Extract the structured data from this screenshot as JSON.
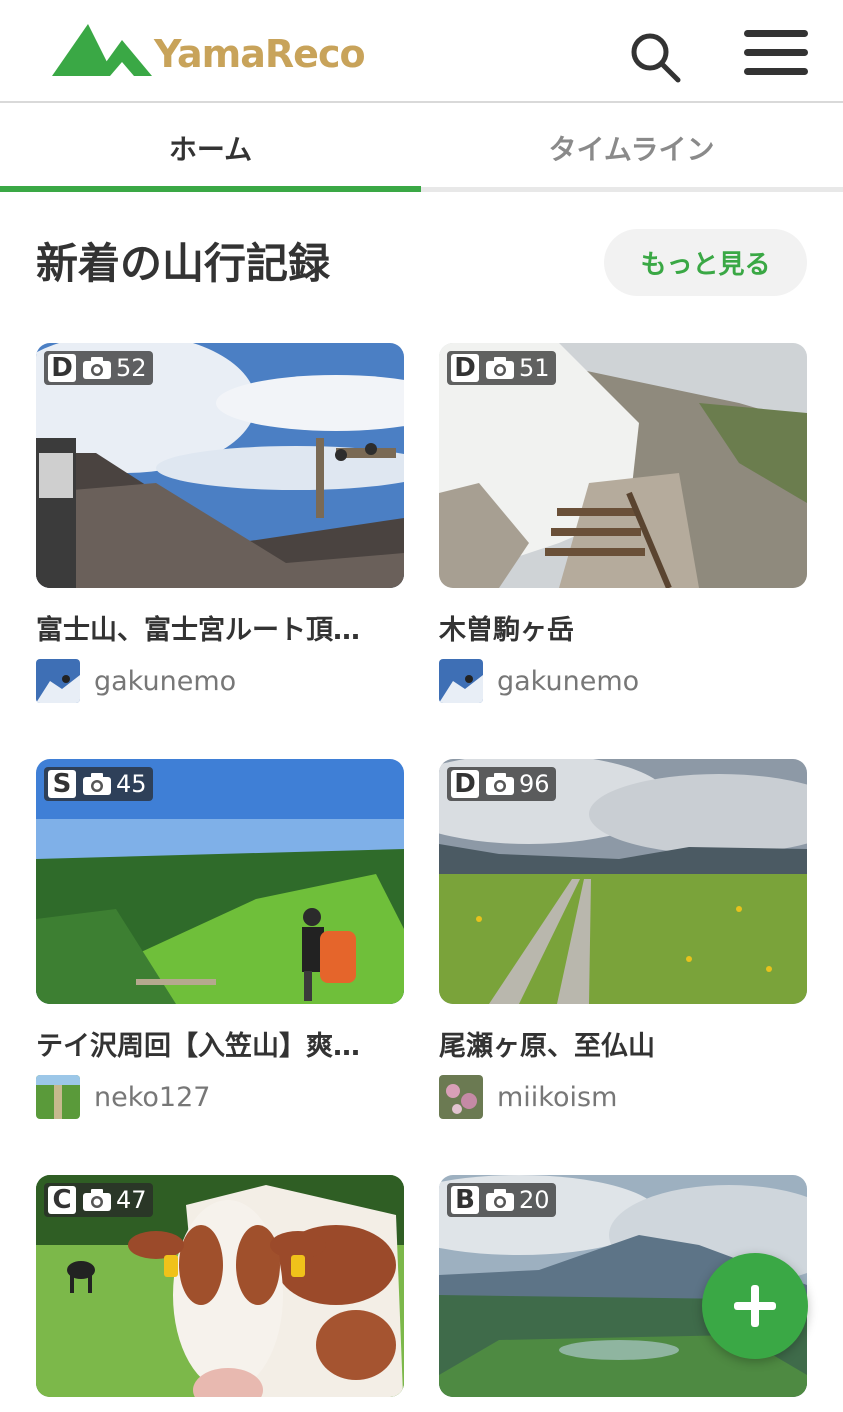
{
  "header": {
    "logo_text": "YamaReco",
    "brand_green": "#3aa845",
    "brand_gold": "#c8a35a",
    "search_icon": "search-icon",
    "menu_icon": "hamburger-menu-icon"
  },
  "tabs": [
    {
      "label": "ホーム",
      "active": true
    },
    {
      "label": "タイムライン",
      "active": false
    }
  ],
  "section": {
    "title": "新着の山行記録",
    "more_label": "もっと見る"
  },
  "records": [
    {
      "grade": "D",
      "photo_count": "52",
      "title": "富士山、富士宮ルート頂…",
      "user": "gakunemo"
    },
    {
      "grade": "D",
      "photo_count": "51",
      "title": "木曽駒ヶ岳",
      "user": "gakunemo"
    },
    {
      "grade": "S",
      "photo_count": "45",
      "title": "テイ沢周回【入笠山】爽…",
      "user": "neko127"
    },
    {
      "grade": "D",
      "photo_count": "96",
      "title": "尾瀬ヶ原、至仏山",
      "user": "miikoism"
    },
    {
      "grade": "C",
      "photo_count": "47",
      "title": "",
      "user": ""
    },
    {
      "grade": "B",
      "photo_count": "20",
      "title": "",
      "user": ""
    }
  ],
  "fab": {
    "icon": "plus-icon"
  }
}
